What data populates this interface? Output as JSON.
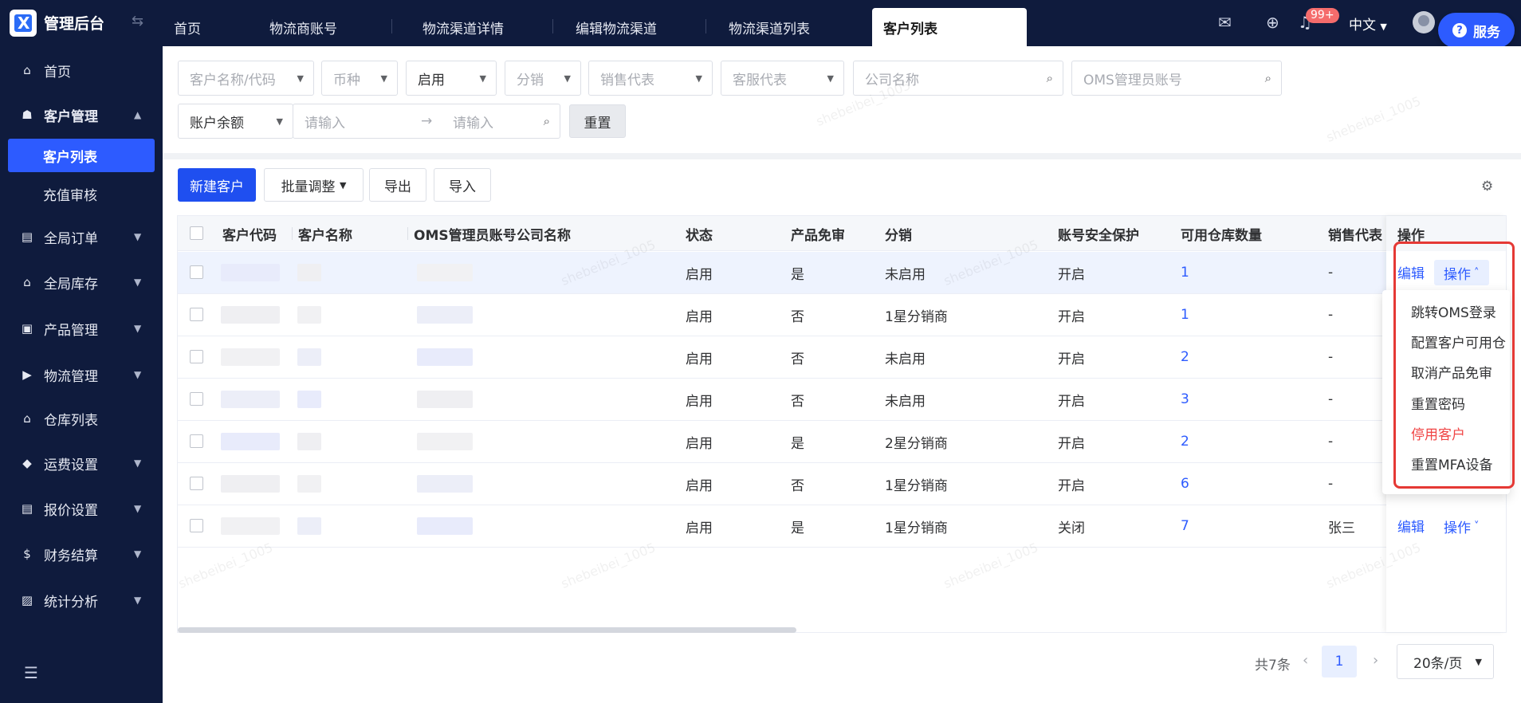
{
  "app": {
    "title": "管理后台"
  },
  "nav": {
    "items": [
      {
        "label": "首页",
        "icon": "home-icon"
      },
      {
        "label": "客户管理",
        "icon": "users-icon",
        "expanded": true
      },
      {
        "label": "全局订单",
        "icon": "order-icon"
      },
      {
        "label": "全局库存",
        "icon": "warehouse-icon"
      },
      {
        "label": "产品管理",
        "icon": "box-icon"
      },
      {
        "label": "物流管理",
        "icon": "truck-icon"
      },
      {
        "label": "仓库列表",
        "icon": "building-icon"
      },
      {
        "label": "运费设置",
        "icon": "freight-icon"
      },
      {
        "label": "报价设置",
        "icon": "quote-icon"
      },
      {
        "label": "财务结算",
        "icon": "dollar-icon"
      },
      {
        "label": "统计分析",
        "icon": "chart-icon"
      }
    ],
    "sub_items": [
      {
        "label": "客户列表",
        "active": true
      },
      {
        "label": "充值审核"
      }
    ]
  },
  "tabs": [
    {
      "label": "首页"
    },
    {
      "label": "物流商账号"
    },
    {
      "label": "物流渠道详情"
    },
    {
      "label": "编辑物流渠道"
    },
    {
      "label": "物流渠道列表"
    },
    {
      "label": "客户列表",
      "active": true
    }
  ],
  "header": {
    "badge": "99+",
    "lang": "中文",
    "service": "服务"
  },
  "filters": {
    "customer": "客户名称/代码",
    "currency": "币种",
    "status": "启用",
    "distribution": "分销",
    "sales_rep": "销售代表",
    "cs_rep": "客服代表",
    "company_placeholder": "公司名称",
    "oms_placeholder": "OMS管理员账号",
    "balance": "账户余额",
    "min_placeholder": "请输入",
    "max_placeholder": "请输入",
    "arrow": "→",
    "reset": "重置"
  },
  "toolbar": {
    "new": "新建客户",
    "batch": "批量调整",
    "export": "导出",
    "import": "导入"
  },
  "table": {
    "headers": [
      "客户代码",
      "客户名称",
      "OMS管理员账号",
      "公司名称",
      "状态",
      "产品免审",
      "分销",
      "账号安全保护",
      "可用仓库数量",
      "销售代表",
      "操作"
    ],
    "rows": [
      {
        "status": "启用",
        "free": "是",
        "dist": "未启用",
        "security": "开启",
        "wh": "1",
        "sales": "-"
      },
      {
        "status": "启用",
        "free": "否",
        "dist": "1星分销商",
        "security": "开启",
        "wh": "1",
        "sales": "-"
      },
      {
        "status": "启用",
        "free": "否",
        "dist": "未启用",
        "security": "开启",
        "wh": "2",
        "sales": "-"
      },
      {
        "status": "启用",
        "free": "否",
        "dist": "未启用",
        "security": "开启",
        "wh": "3",
        "sales": "-"
      },
      {
        "status": "启用",
        "free": "是",
        "dist": "2星分销商",
        "security": "开启",
        "wh": "2",
        "sales": "-"
      },
      {
        "status": "启用",
        "free": "否",
        "dist": "1星分销商",
        "security": "开启",
        "wh": "6",
        "sales": "-"
      },
      {
        "status": "启用",
        "free": "是",
        "dist": "1星分销商",
        "security": "关闭",
        "wh": "7",
        "sales": "张三"
      }
    ],
    "edit_label": "编辑",
    "ops_label": "操作"
  },
  "dropdown": {
    "items": [
      {
        "label": "跳转OMS登录"
      },
      {
        "label": "配置客户可用仓"
      },
      {
        "label": "取消产品免审"
      },
      {
        "label": "重置密码"
      },
      {
        "label": "停用客户",
        "danger": true
      },
      {
        "label": "重置MFA设备"
      }
    ]
  },
  "pagination": {
    "total": "共7条",
    "current": "1",
    "page_size": "20条/页"
  },
  "watermark": "shebeibei_1005",
  "colors": {
    "primary": "#2d5bff",
    "sidebar": "#0f1b3d",
    "danger": "#f04545",
    "highlight": "#e53935"
  }
}
